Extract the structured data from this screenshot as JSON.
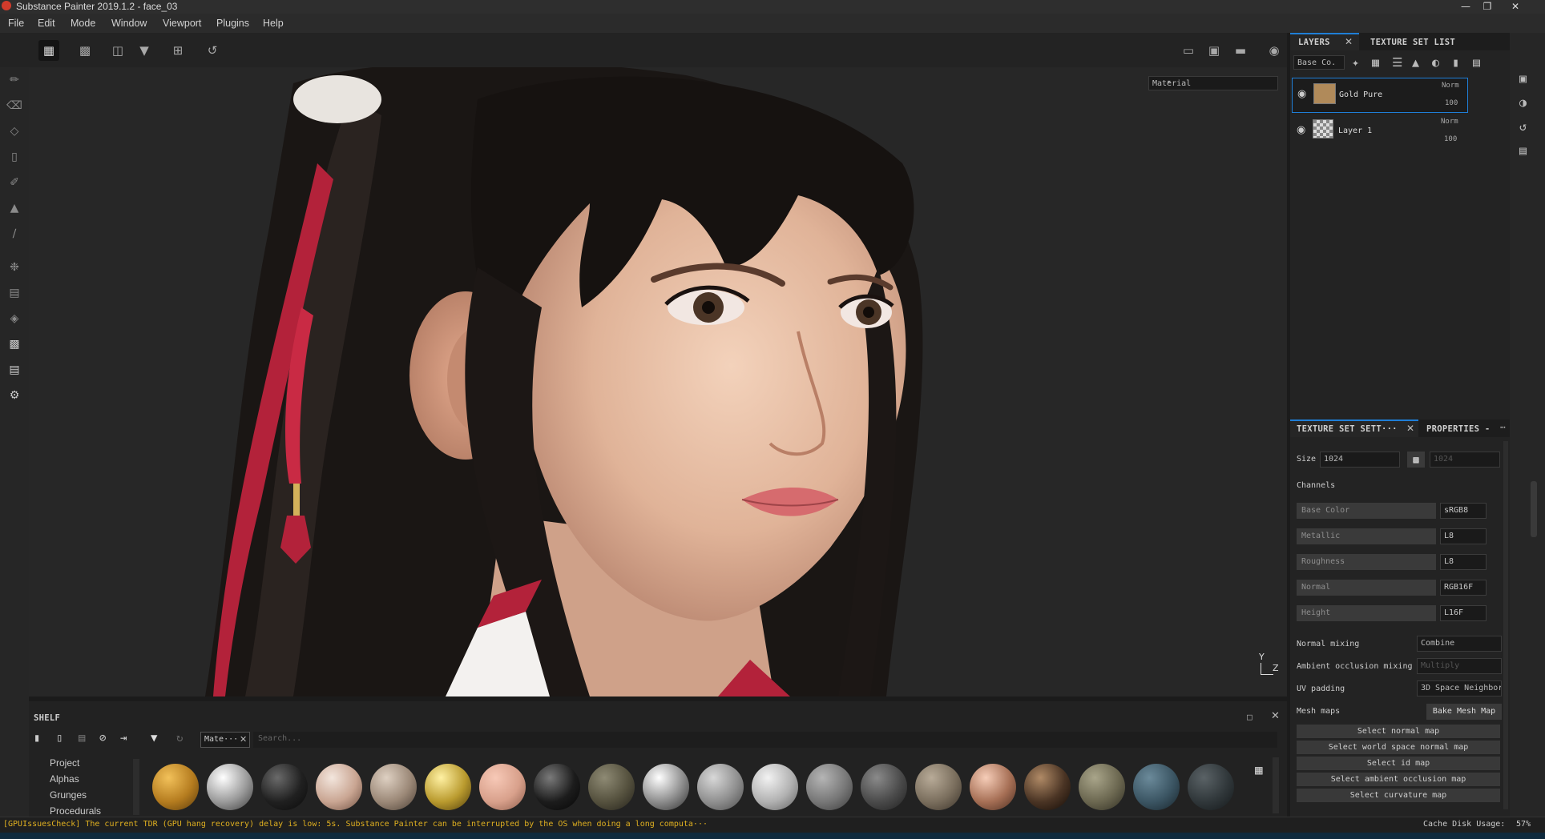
{
  "window": {
    "title": "Substance Painter 2019.1.2 - face_03",
    "controls": [
      "minimize",
      "restore",
      "close"
    ]
  },
  "menu": [
    "File",
    "Edit",
    "Mode",
    "Window",
    "Viewport",
    "Plugins",
    "Help"
  ],
  "viewport": {
    "mode_dropdown": "Material",
    "axis_labels": {
      "y": "Y",
      "z": "Z"
    }
  },
  "layers_panel": {
    "tabs": [
      "LAYERS",
      "TEXTURE SET LIST"
    ],
    "channel_dropdown": "Base Co.",
    "layers": [
      {
        "name": "Gold Pure",
        "blend": "Norm",
        "opacity": "100",
        "selected": true,
        "thumb_color": "#b08a5a"
      },
      {
        "name": "Layer 1",
        "blend": "Norm",
        "opacity": "100",
        "selected": false
      }
    ]
  },
  "texture_set_settings": {
    "tabs": [
      "TEXTURE SET SETT···",
      "PROPERTIES -"
    ],
    "size_label": "Size",
    "size_value": "1024",
    "size_locked_value": "1024",
    "channels_label": "Channels",
    "channels": [
      {
        "name": "Base Color",
        "format": "sRGB8"
      },
      {
        "name": "Metallic",
        "format": "L8"
      },
      {
        "name": "Roughness",
        "format": "L8"
      },
      {
        "name": "Normal",
        "format": "RGB16F"
      },
      {
        "name": "Height",
        "format": "L16F"
      }
    ],
    "normal_mixing_label": "Normal mixing",
    "normal_mixing_value": "Combine",
    "ao_mixing_label": "Ambient occlusion mixing",
    "ao_mixing_value": "Multiply",
    "uv_padding_label": "UV padding",
    "uv_padding_value": "3D Space Neighbor",
    "mesh_maps_label": "Mesh maps",
    "bake_button": "Bake Mesh Map",
    "map_buttons": [
      "Select normal map",
      "Select world space normal map",
      "Select id map",
      "Select ambient occlusion map",
      "Select curvature map"
    ]
  },
  "shelf": {
    "title": "SHELF",
    "filter_tag": "Mate···",
    "search_placeholder": "Search...",
    "categories": [
      "Project",
      "Alphas",
      "Grunges",
      "Procedurals"
    ]
  },
  "status": {
    "message": "[GPUIssuesCheck] The current TDR (GPU hang recovery) delay is low: 5s. Substance Painter can be interrupted by the OS when doing a long computa···",
    "cache_label": "Cache Disk Usage:",
    "cache_value": "57%"
  }
}
